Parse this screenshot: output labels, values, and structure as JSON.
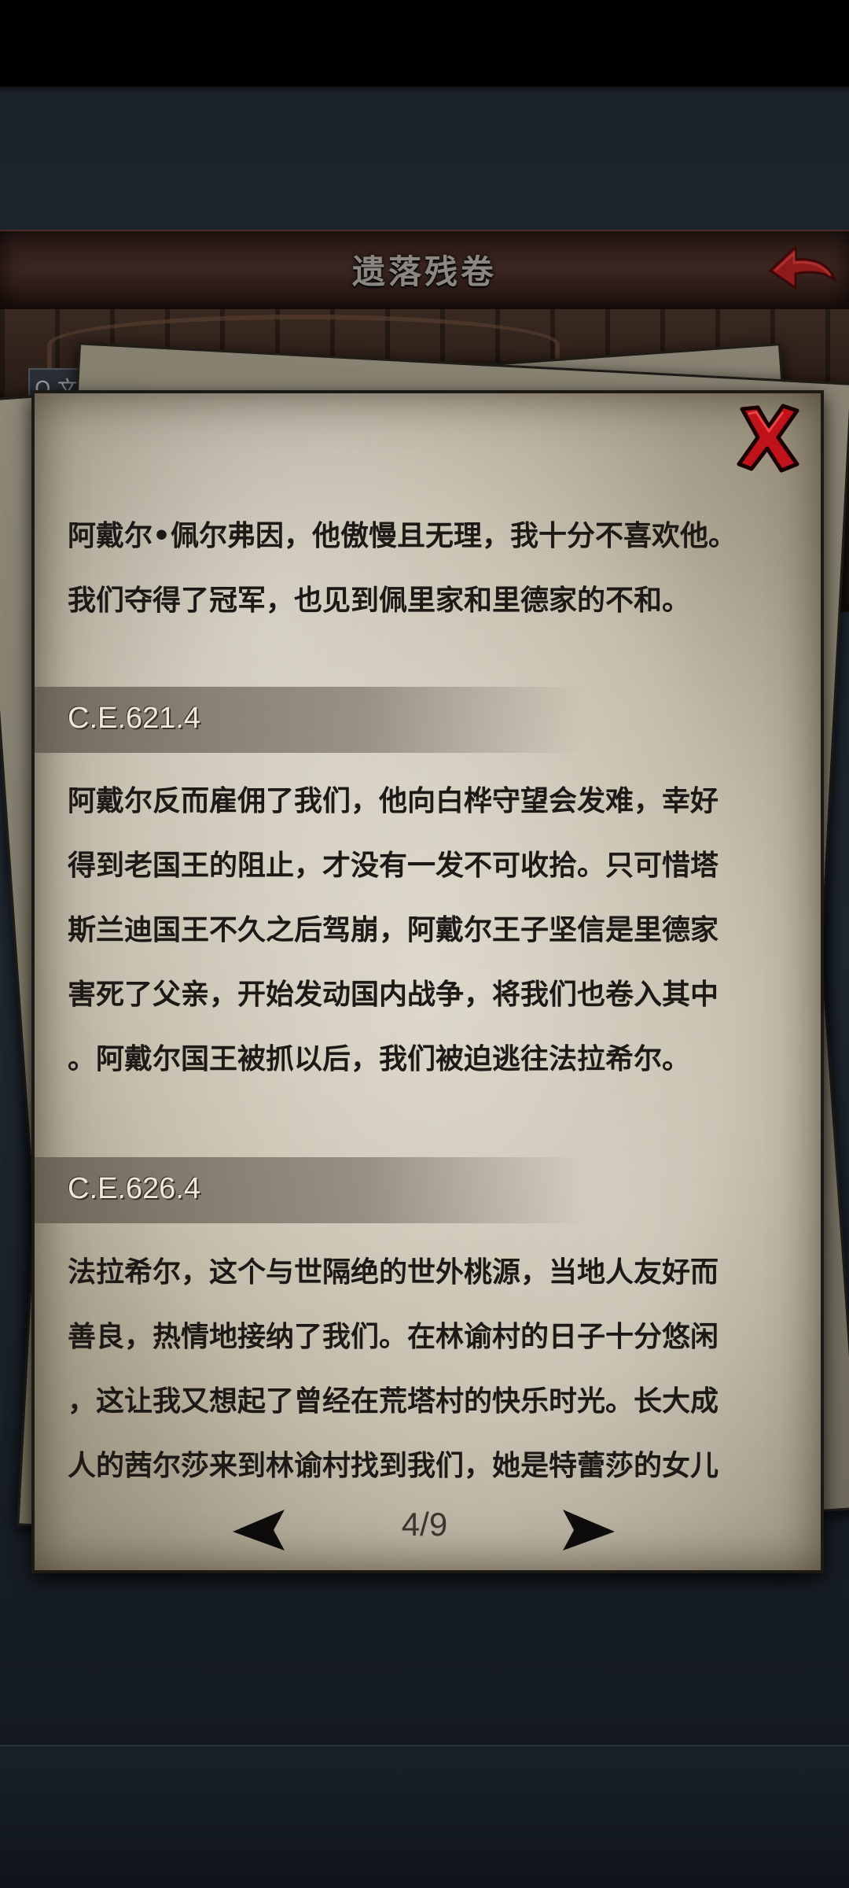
{
  "header": {
    "title": "遗落残卷",
    "back_icon": "back-arrow-icon"
  },
  "background": {
    "search_stub": "Q 文"
  },
  "scroll": {
    "close_icon": "close-x-icon",
    "entries": [
      {
        "text": "阿戴尔•佩尔弗因，他傲慢且无理，我十分不喜欢他。\n我们夺得了冠军，也见到佩里家和里德家的不和。"
      },
      {
        "date": "C.E.621.4",
        "text": "阿戴尔反而雇佣了我们，他向白桦守望会发难，幸好\n得到老国王的阻止，才没有一发不可收拾。只可惜塔\n斯兰迪国王不久之后驾崩，阿戴尔王子坚信是里德家\n害死了父亲，开始发动国内战争，将我们也卷入其中\n。阿戴尔国王被抓以后，我们被迫逃往法拉希尔。"
      },
      {
        "date": "C.E.626.4",
        "text": "法拉希尔，这个与世隔绝的世外桃源，当地人友好而\n善良，热情地接纳了我们。在林谕村的日子十分悠闲\n，这让我又想起了曾经在荒塔村的快乐时光。长大成\n人的茜尔莎来到林谕村找到我们，她是特蕾莎的女儿"
      }
    ]
  },
  "pager": {
    "current": "4/9",
    "prev_icon": "left-triangle-icon",
    "next_icon": "right-triangle-icon"
  },
  "colors": {
    "close_red": "#c0121b",
    "back_red": "#8e1a1a",
    "ink": "#1c1916",
    "paper": "#c8c0ad"
  }
}
